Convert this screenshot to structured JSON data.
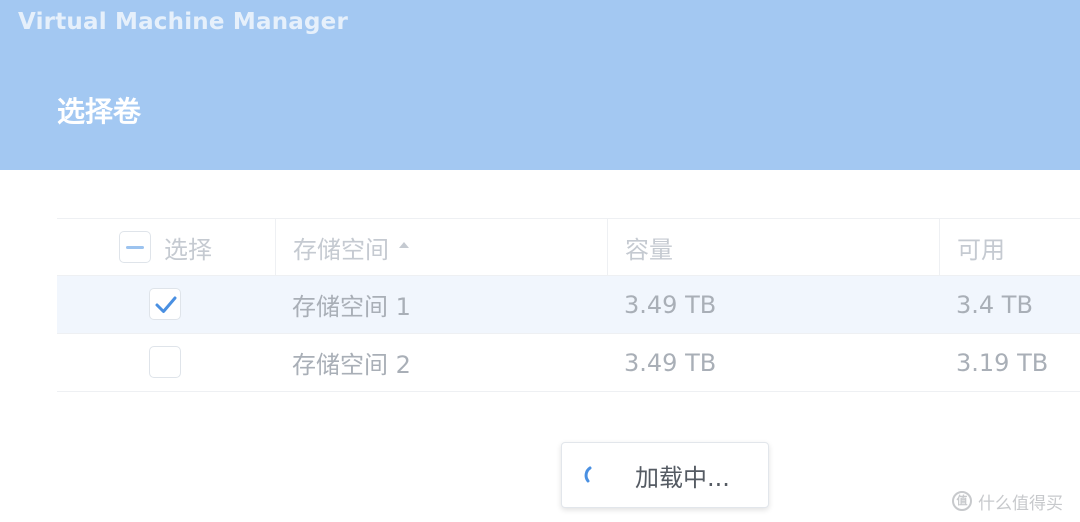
{
  "app": {
    "title": "Virtual Machine Manager"
  },
  "dialog": {
    "title": "选择卷"
  },
  "table": {
    "columns": {
      "select": "选择",
      "storage": "存储空间",
      "capacity": "容量",
      "available": "可用"
    },
    "sort": {
      "column": "storage",
      "direction": "ascending"
    },
    "header_checkbox_state": "indeterminate",
    "rows": [
      {
        "selected": true,
        "storage": "存储空间 1",
        "capacity": "3.49 TB",
        "available": "3.4 TB"
      },
      {
        "selected": false,
        "storage": "存储空间 2",
        "capacity": "3.49 TB",
        "available": "3.19 TB"
      }
    ]
  },
  "loading": {
    "text": "加载中..."
  },
  "watermark": {
    "text": "什么值得买",
    "logo_glyph": "值"
  },
  "colors": {
    "header_bg": "#a3c8f2",
    "accent": "#4a90e2",
    "selected_row_bg": "#f1f6fd"
  }
}
